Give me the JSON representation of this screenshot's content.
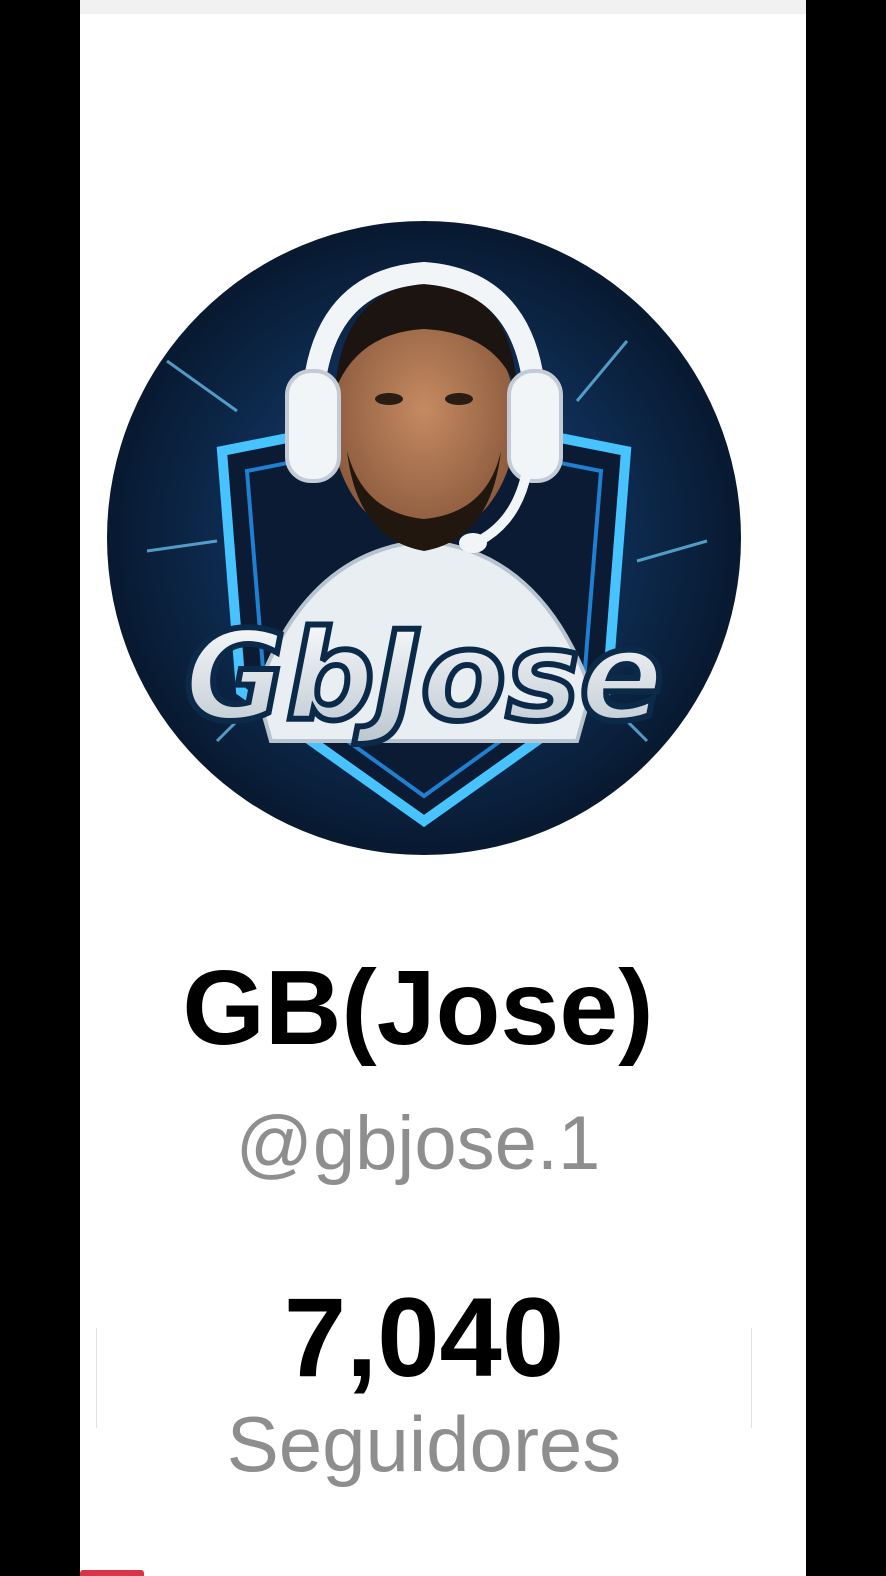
{
  "profile": {
    "display_name": "GB(Jose)",
    "handle": "@gbjose.1",
    "avatar_logo_text": "GbJose"
  },
  "stats": {
    "followers_count": "7,040",
    "followers_label": "Seguidores"
  },
  "colors": {
    "background_outer": "#000000",
    "card_background": "#ffffff",
    "name_text": "#000000",
    "muted_text": "#8e8e8e",
    "avatar_glow": "#3fb5ff",
    "avatar_dark": "#0b1a2e",
    "accent": "#d8344a"
  },
  "icons": {
    "avatar": "avatar"
  }
}
